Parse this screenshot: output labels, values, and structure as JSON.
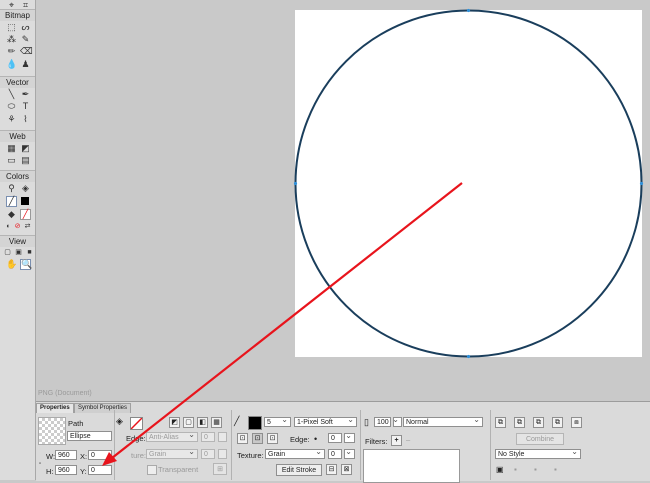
{
  "tools": {
    "sections": [
      "Bitmap",
      "Vector",
      "Web",
      "Colors",
      "View"
    ]
  },
  "document": {
    "label": "PNG (Document)"
  },
  "properties": {
    "tabs": [
      "Properties",
      "Symbol Properties"
    ],
    "object_type": "Path",
    "object_name": "Ellipse",
    "w_label": "W:",
    "w_value": "960",
    "h_label": "H:",
    "h_value": "960",
    "x_label": "X:",
    "x_value": "0",
    "y_label": "Y:",
    "y_value": "0",
    "fill_edge_label": "Edge:",
    "fill_edge_value": "Anti-Alias",
    "fill_edge_amount": "0",
    "fill_texture_label": "ture:",
    "fill_texture_value": "Grain",
    "fill_texture_amount": "0",
    "transparent_label": "Transparent",
    "stroke_size": "5",
    "stroke_type": "1-Pixel Soft",
    "stroke_edge_label": "Edge:",
    "stroke_edge_value": "0",
    "stroke_texture_label": "Texture:",
    "stroke_texture_value": "Grain",
    "stroke_texture_amount": "0",
    "edit_stroke_label": "Edit Stroke",
    "opacity_value": "100",
    "blend_mode": "Normal",
    "filters_label": "Filters:",
    "combine_label": "Combine",
    "style_value": "No Style"
  },
  "colors": {
    "circle_stroke": "#1a3e5c",
    "arrow": "#e8141c",
    "selection": "#2f8fd8"
  }
}
